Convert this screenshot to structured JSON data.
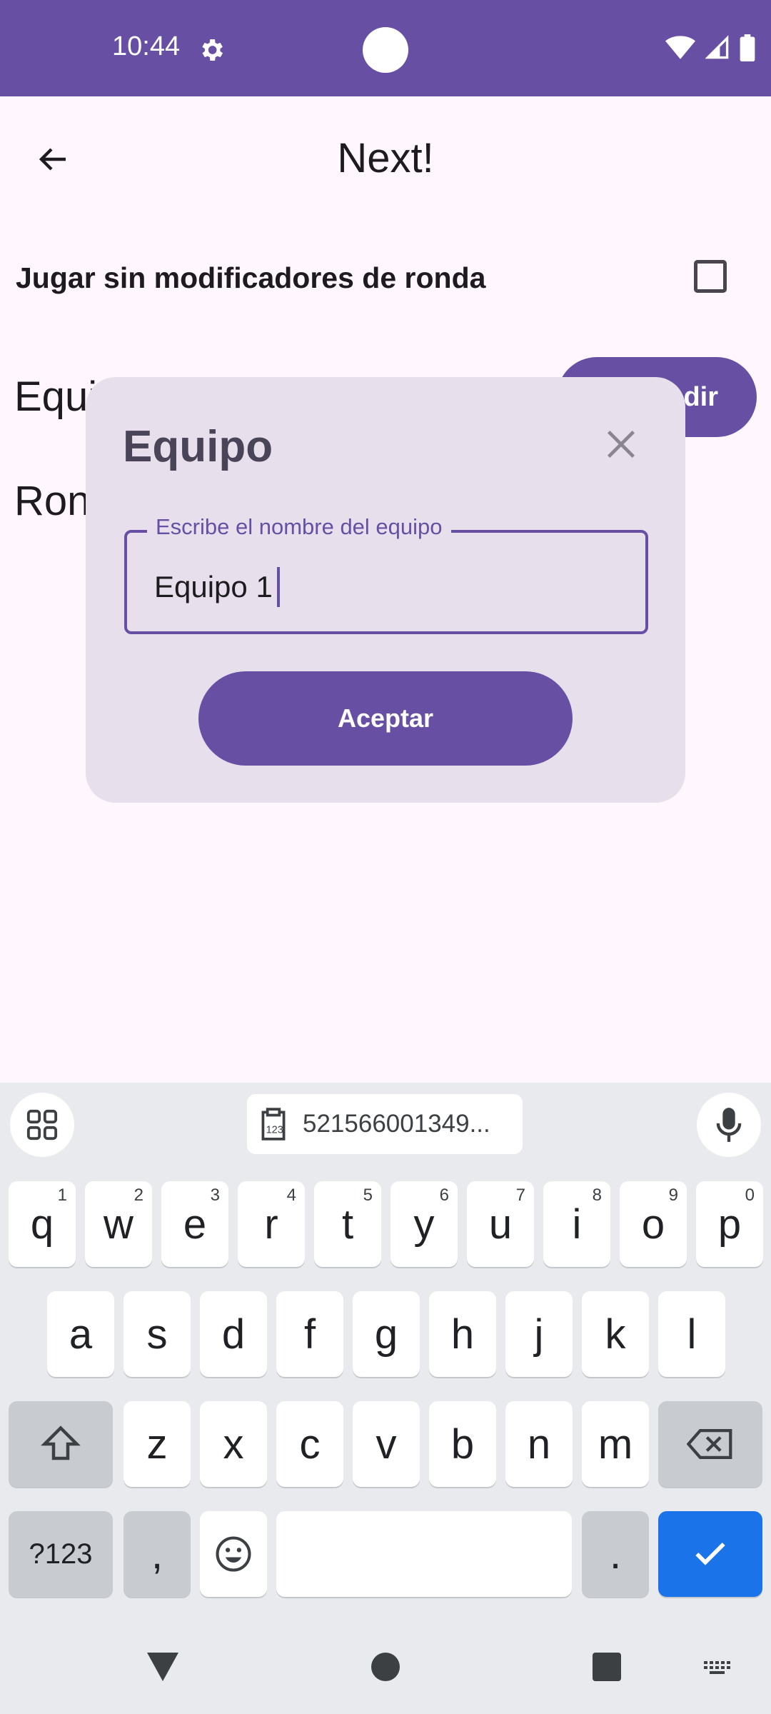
{
  "status": {
    "time": "10:44"
  },
  "app_bar": {
    "title": "Next!"
  },
  "settings": {
    "no_modifiers_label": "Jugar sin modificadores de ronda"
  },
  "content": {
    "teams_label": "Equi",
    "add_button": "dir",
    "rounds_label": "Ron"
  },
  "dialog": {
    "title": "Equipo",
    "field_label": "Escribe el nombre del equipo",
    "field_value": "Equipo 1",
    "accept_label": "Aceptar"
  },
  "keyboard": {
    "clipboard_text": "521566001349...",
    "row1": [
      "q",
      "w",
      "e",
      "r",
      "t",
      "y",
      "u",
      "i",
      "o",
      "p"
    ],
    "row1_nums": [
      "1",
      "2",
      "3",
      "4",
      "5",
      "6",
      "7",
      "8",
      "9",
      "0"
    ],
    "row2": [
      "a",
      "s",
      "d",
      "f",
      "g",
      "h",
      "j",
      "k",
      "l"
    ],
    "row3": [
      "z",
      "x",
      "c",
      "v",
      "b",
      "n",
      "m"
    ],
    "sym_label": "?123",
    "comma": ",",
    "period": "."
  },
  "colors": {
    "primary": "#6750a4",
    "surface": "#fff7fd",
    "dialog": "#e7e0ec",
    "enter": "#1a73e8"
  },
  "icons": [
    "gear-icon",
    "wifi-icon",
    "signal-icon",
    "battery-icon",
    "back-arrow-icon",
    "close-icon",
    "apps-grid-icon",
    "clipboard-icon",
    "mic-icon",
    "shift-icon",
    "backspace-icon",
    "emoji-icon",
    "check-icon",
    "nav-back-icon",
    "nav-home-icon",
    "nav-recents-icon",
    "keyboard-switch-icon"
  ]
}
